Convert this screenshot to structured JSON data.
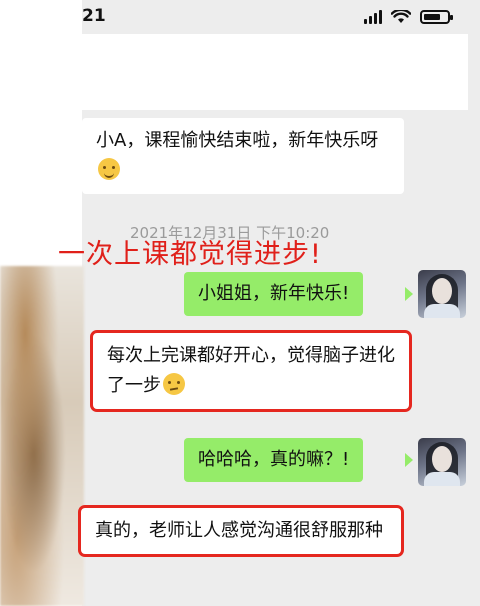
{
  "status_bar": {
    "time": "21"
  },
  "timestamp": "2021年12月31日 下午10:20",
  "overlay_headline": "一次上课都觉得进步!",
  "messages": [
    {
      "side": "left",
      "text": "小A，课程愉快结束啦，新年快乐呀",
      "emoji": "smile-emoji"
    },
    {
      "side": "right",
      "text": "小姐姐，新年快乐!"
    },
    {
      "side": "left",
      "text": "每次上完课都好开心，觉得脑子进化了一步",
      "emoji": "thinking-emoji",
      "highlighted": true
    },
    {
      "side": "right",
      "text": "哈哈哈，真的嘛？!"
    },
    {
      "side": "left",
      "text": "真的，老师让人感觉沟通很舒服那种",
      "highlighted": true
    }
  ],
  "colors": {
    "background": "#ededed",
    "sent_bubble": "#95ec69",
    "received_bubble": "#ffffff",
    "highlight_border": "#e5271f",
    "headline": "#e0201a"
  }
}
